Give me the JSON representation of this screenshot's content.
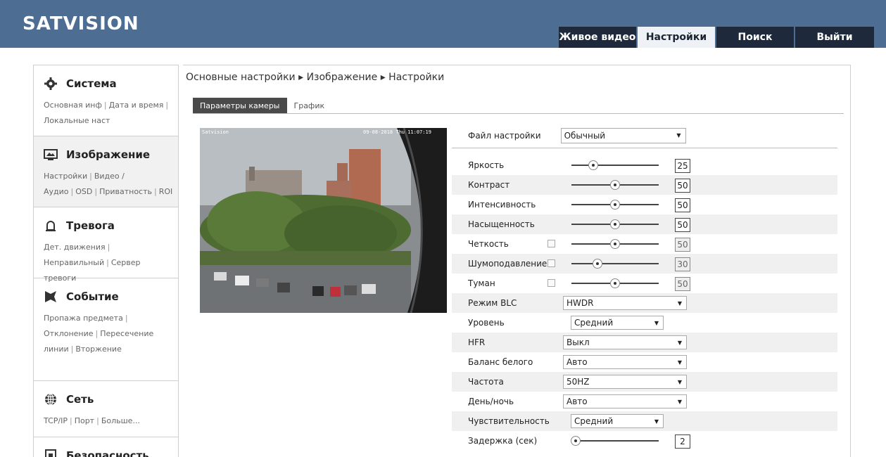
{
  "logo": {
    "text": "SATVISION"
  },
  "nav": [
    {
      "label": "Живое видео",
      "active": false
    },
    {
      "label": "Настройки",
      "active": true
    },
    {
      "label": "Поиск",
      "active": false
    },
    {
      "label": "Выйти",
      "active": false
    }
  ],
  "sidebar": [
    {
      "title": "Система",
      "icon": "gear-icon",
      "links": [
        "Основная инф",
        "Дата и время",
        "Локальные наст"
      ]
    },
    {
      "title": "Изображение",
      "icon": "image-icon",
      "links": [
        "Настройки",
        "Видео / Аудио",
        "OSD",
        "Приватность",
        "ROI"
      ]
    },
    {
      "title": "Тревога",
      "icon": "alarm-icon",
      "links": [
        "Дет. движения",
        "Неправильный",
        "Сервер тревоги"
      ]
    },
    {
      "title": "Событие",
      "icon": "event-icon",
      "links": [
        "Пропажа предмета",
        "Отклонение",
        "Пересечение линии",
        "Вторжение"
      ]
    },
    {
      "title": "Сеть",
      "icon": "globe-icon",
      "links": [
        "TCP/IP",
        "Порт",
        "Больше..."
      ]
    },
    {
      "title": "Безопасность",
      "icon": "security-icon",
      "links": []
    }
  ],
  "breadcrumb": "Основные настройки ▸ Изображение ▸ Настройки",
  "subtabs": [
    {
      "label": "Параметры камеры",
      "active": true
    },
    {
      "label": "График",
      "active": false
    }
  ],
  "preview": {
    "osd_name": "Satvision",
    "osd_time": "09-08-2018 Thu 11:07:19"
  },
  "file": {
    "label": "Файл настройки",
    "value": "Обычный"
  },
  "sliders": [
    {
      "label": "Яркость",
      "value": 25,
      "checkbox": false,
      "disabled": false
    },
    {
      "label": "Контраст",
      "value": 50,
      "checkbox": false,
      "disabled": false
    },
    {
      "label": "Интенсивность",
      "value": 50,
      "checkbox": false,
      "disabled": false
    },
    {
      "label": "Насыщенность",
      "value": 50,
      "checkbox": false,
      "disabled": false
    },
    {
      "label": "Четкость",
      "value": 50,
      "checkbox": true,
      "disabled": true
    },
    {
      "label": "Шумоподавление",
      "value": 30,
      "checkbox": true,
      "disabled": true
    },
    {
      "label": "Туман",
      "value": 50,
      "checkbox": true,
      "disabled": true
    }
  ],
  "selects": [
    {
      "label": "Режим BLC",
      "value": "HWDR",
      "style": "wide"
    },
    {
      "label": "Уровень",
      "value": "Средний",
      "style": "short"
    },
    {
      "label": "HFR",
      "value": "Выкл",
      "style": "wide"
    },
    {
      "label": "Баланс белого",
      "value": "Авто",
      "style": "wide"
    },
    {
      "label": "Частота",
      "value": "50HZ",
      "style": "wide"
    },
    {
      "label": "День/ночь",
      "value": "Авто",
      "style": "wide"
    },
    {
      "label": "Чувствительность",
      "value": "Средний",
      "style": "short"
    }
  ],
  "delay": {
    "label": "Задержка (сек)",
    "value": 2
  }
}
